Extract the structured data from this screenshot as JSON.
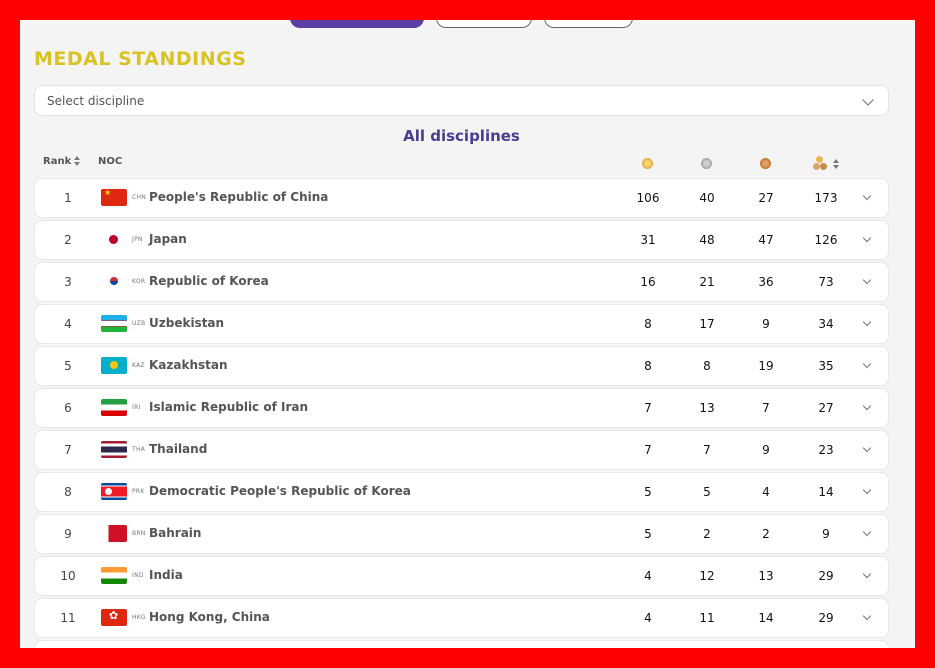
{
  "title": "MEDAL STANDINGS",
  "discipline_select": {
    "placeholder": "Select discipline"
  },
  "subtitle": "All disciplines",
  "headers": {
    "rank": "Rank",
    "noc": "NOC"
  },
  "icons": {
    "gold": "gold-medal-icon",
    "silver": "silver-medal-icon",
    "bronze": "bronze-medal-icon",
    "total": "total-medals-icon"
  },
  "colors": {
    "title": "#d9c224",
    "subtitle": "#4a3d8f",
    "active_tab": "#5a3fa4",
    "frame": "#ff0000"
  },
  "rows": [
    {
      "rank": "1",
      "code": "CHN",
      "name": "People's Republic of China",
      "gold": "106",
      "silver": "40",
      "bronze": "27",
      "total": "173"
    },
    {
      "rank": "2",
      "code": "JPN",
      "name": "Japan",
      "gold": "31",
      "silver": "48",
      "bronze": "47",
      "total": "126"
    },
    {
      "rank": "3",
      "code": "KOR",
      "name": "Republic of Korea",
      "gold": "16",
      "silver": "21",
      "bronze": "36",
      "total": "73"
    },
    {
      "rank": "4",
      "code": "UZB",
      "name": "Uzbekistan",
      "gold": "8",
      "silver": "17",
      "bronze": "9",
      "total": "34"
    },
    {
      "rank": "5",
      "code": "KAZ",
      "name": "Kazakhstan",
      "gold": "8",
      "silver": "8",
      "bronze": "19",
      "total": "35"
    },
    {
      "rank": "6",
      "code": "IRI",
      "name": "Islamic Republic of Iran",
      "gold": "7",
      "silver": "13",
      "bronze": "7",
      "total": "27"
    },
    {
      "rank": "7",
      "code": "THA",
      "name": "Thailand",
      "gold": "7",
      "silver": "7",
      "bronze": "9",
      "total": "23"
    },
    {
      "rank": "8",
      "code": "PRK",
      "name": "Democratic People's Republic of Korea",
      "gold": "5",
      "silver": "5",
      "bronze": "4",
      "total": "14"
    },
    {
      "rank": "9",
      "code": "BRN",
      "name": "Bahrain",
      "gold": "5",
      "silver": "2",
      "bronze": "2",
      "total": "9"
    },
    {
      "rank": "10",
      "code": "IND",
      "name": "India",
      "gold": "4",
      "silver": "12",
      "bronze": "13",
      "total": "29"
    },
    {
      "rank": "11",
      "code": "HKG",
      "name": "Hong Kong, China",
      "gold": "4",
      "silver": "11",
      "bronze": "14",
      "total": "29"
    }
  ]
}
